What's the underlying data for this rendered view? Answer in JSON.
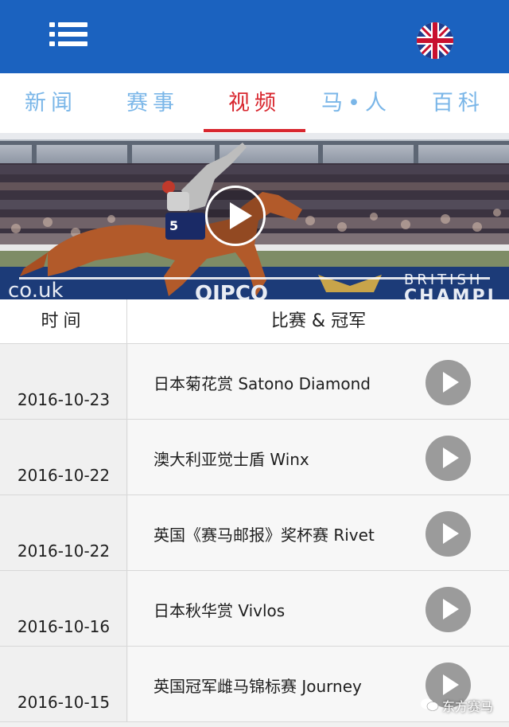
{
  "header": {
    "menu_icon": "hamburger-menu-icon",
    "language_icon": "uk-flag-icon",
    "colors": {
      "bar": "#1b62bf"
    }
  },
  "tabs": [
    {
      "label": "新闻",
      "active": false
    },
    {
      "label": "赛事",
      "active": false
    },
    {
      "label": "视频",
      "active": true
    },
    {
      "label": "马•人",
      "active": false
    },
    {
      "label": "百科",
      "active": false
    }
  ],
  "tab_colors": {
    "inactive": "#7ab6e8",
    "active": "#d8262e"
  },
  "hero": {
    "saddle_number": "5",
    "rail_text_left": "co.uk",
    "rail_text_mid": "QIPCO",
    "rail_text_right_top": "BRITISH",
    "rail_text_right_bottom": "CHAMPI",
    "play_icon": "play-icon"
  },
  "table": {
    "header": {
      "date": "时间",
      "race": "比赛 & 冠军"
    },
    "rows": [
      {
        "date": "2016-10-23",
        "title": "日本菊花赏 Satono Diamond"
      },
      {
        "date": "2016-10-22",
        "title": "澳大利亚觉士盾 Winx"
      },
      {
        "date": "2016-10-22",
        "title": "英国《赛马邮报》奖杯赛 Rivet"
      },
      {
        "date": "2016-10-16",
        "title": "日本秋华赏 Vivlos"
      },
      {
        "date": "2016-10-15",
        "title": "英国冠军雌马锦标赛 Journey"
      }
    ]
  },
  "watermark": {
    "text": "东方赛马",
    "icon": "wechat-icon"
  }
}
